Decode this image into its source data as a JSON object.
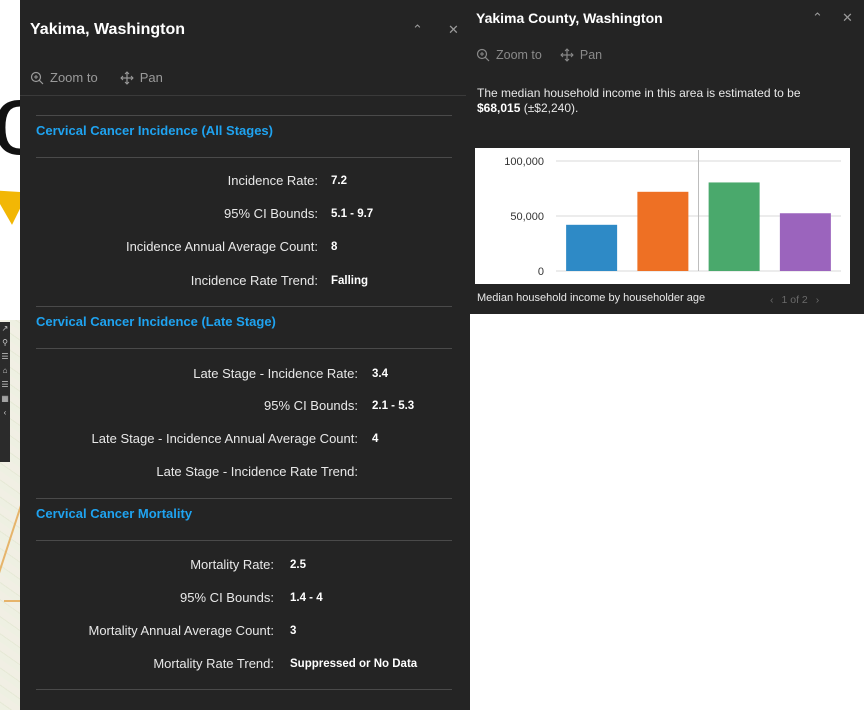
{
  "left_popup": {
    "title": "Yakima, Washington",
    "actions": {
      "zoom_to": "Zoom to",
      "pan": "Pan"
    },
    "sections": [
      {
        "title": "Cervical Cancer Incidence (All Stages)",
        "rows": [
          {
            "label": "Incidence Rate:",
            "value": "7.2"
          },
          {
            "label": "95% CI Bounds:",
            "value": "5.1 - 9.7"
          },
          {
            "label": "Incidence Annual Average Count:",
            "value": "8"
          },
          {
            "label": "Incidence Rate Trend:",
            "value": "Falling"
          }
        ]
      },
      {
        "title": "Cervical Cancer Incidence (Late Stage)",
        "rows": [
          {
            "label": "Late Stage - Incidence Rate:",
            "value": "3.4"
          },
          {
            "label": "95% CI Bounds:",
            "value": "2.1 - 5.3"
          },
          {
            "label": "Late Stage - Incidence Annual Average Count:",
            "value": "4"
          },
          {
            "label": "Late Stage - Incidence Rate Trend:",
            "value": ""
          }
        ]
      },
      {
        "title": "Cervical Cancer Mortality",
        "rows": [
          {
            "label": "Mortality Rate:",
            "value": "2.5"
          },
          {
            "label": "95% CI Bounds:",
            "value": "1.4 - 4"
          },
          {
            "label": "Mortality Annual Average Count:",
            "value": "3"
          },
          {
            "label": "Mortality Rate Trend:",
            "value": "Suppressed or No Data"
          }
        ]
      }
    ]
  },
  "right_popup": {
    "title": "Yakima County, Washington",
    "actions": {
      "zoom_to": "Zoom to",
      "pan": "Pan"
    },
    "text_before": "The median household income in this area is estimated to be ",
    "income_value": "$68,015",
    "text_after": " (±$2,240).",
    "caption": "Median household income by householder age",
    "pager": "1 of 2"
  },
  "chart_data": {
    "type": "bar",
    "categories": [
      "",
      "",
      "",
      ""
    ],
    "values": [
      42000,
      72000,
      80500,
      52500
    ],
    "colors": [
      "#2e8ac6",
      "#ee7024",
      "#4aa96c",
      "#9b64bd"
    ],
    "y_ticks": [
      "0",
      "50,000",
      "100,000"
    ],
    "ylim": [
      0,
      110000
    ],
    "grid": true,
    "title": "",
    "xlabel": "",
    "ylabel": ""
  }
}
